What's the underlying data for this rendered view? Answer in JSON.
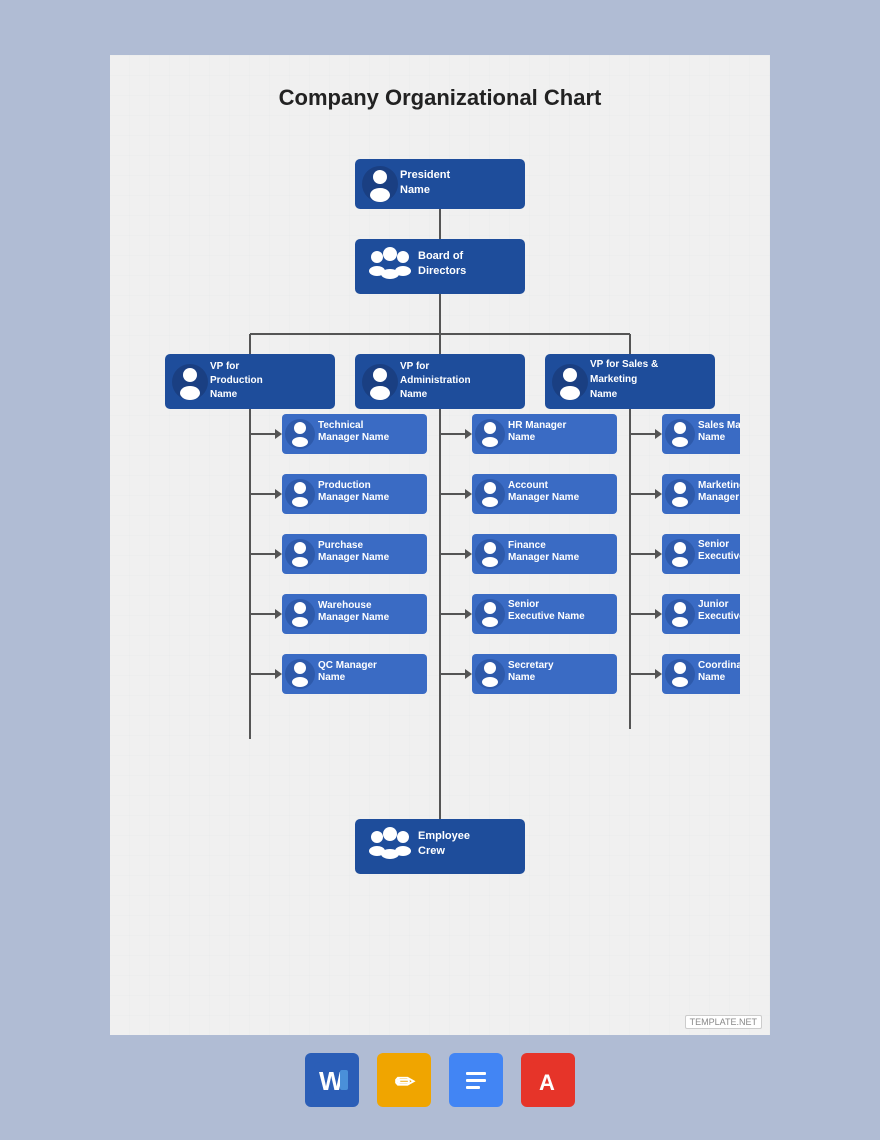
{
  "page": {
    "title": "Company Organizational Chart",
    "background_color": "#b0bcd4",
    "paper_color": "#f0f0f0"
  },
  "chart": {
    "title": "Company Organizational Chart",
    "nodes": {
      "president": {
        "title": "President",
        "subtitle": "Name"
      },
      "board": {
        "title": "Board of",
        "subtitle": "Directors"
      },
      "vp_production": {
        "title": "VP for Production",
        "subtitle": "Name"
      },
      "vp_admin": {
        "title": "VP for Administration",
        "subtitle": "Name"
      },
      "vp_sales": {
        "title": "VP for Sales & Marketing",
        "subtitle": "Name"
      },
      "technical_mgr": {
        "title": "Technical Manager",
        "subtitle": "Name"
      },
      "production_mgr": {
        "title": "Production Manager",
        "subtitle": "Name"
      },
      "purchase_mgr": {
        "title": "Purchase Manager",
        "subtitle": "Name"
      },
      "warehouse_mgr": {
        "title": "Warehouse Manager",
        "subtitle": "Name"
      },
      "qc_mgr": {
        "title": "QC Manager",
        "subtitle": "Name"
      },
      "hr_mgr": {
        "title": "HR Manager",
        "subtitle": "Name"
      },
      "account_mgr": {
        "title": "Account Manager",
        "subtitle": "Name"
      },
      "finance_mgr": {
        "title": "Finance Manager",
        "subtitle": "Name"
      },
      "senior_exec_admin": {
        "title": "Senior Executive",
        "subtitle": "Name"
      },
      "secretary": {
        "title": "Secretary",
        "subtitle": "Name"
      },
      "sales_mgr": {
        "title": "Sales Manager",
        "subtitle": "Name"
      },
      "marketing_mgr": {
        "title": "Marketing Manager",
        "subtitle": "Name"
      },
      "senior_exec_sales": {
        "title": "Senior Executive",
        "subtitle": "Name"
      },
      "junior_exec": {
        "title": "Junior Executive",
        "subtitle": "Name"
      },
      "coordinator": {
        "title": "Coordinator",
        "subtitle": "Name"
      },
      "employee_crew": {
        "title": "Employee",
        "subtitle": "Crew"
      }
    }
  },
  "footer": {
    "icons": [
      {
        "name": "word",
        "label": "W",
        "color": "#2b5eb7",
        "letter": "W"
      },
      {
        "name": "pages",
        "label": "Pages",
        "color": "#f0a500",
        "letter": "✏"
      },
      {
        "name": "docs",
        "label": "Docs",
        "color": "#4285f4",
        "letter": "≡"
      },
      {
        "name": "acrobat",
        "label": "Acrobat",
        "color": "#e63429",
        "letter": "A"
      }
    ],
    "watermark": "TEMPLATE.NET"
  }
}
